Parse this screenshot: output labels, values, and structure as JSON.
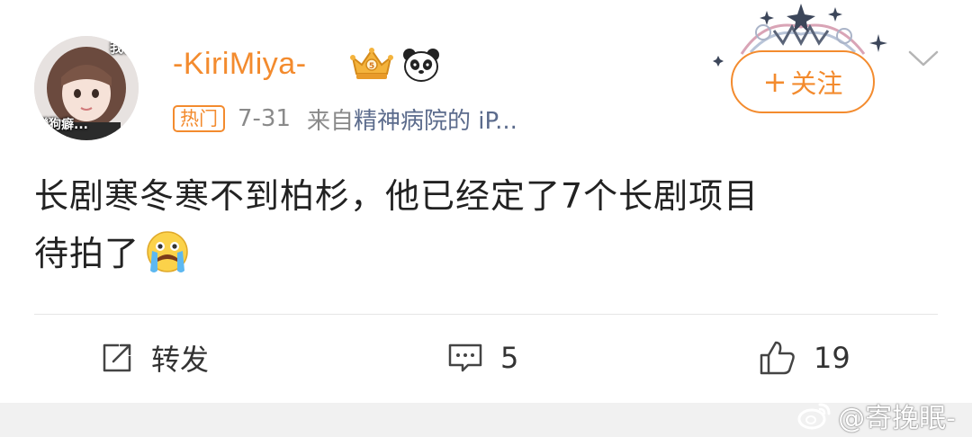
{
  "avatar": {
    "caption_top": "我佾",
    "caption_bottom": "戀狗癖..."
  },
  "user": {
    "name": "-KiriMiya-"
  },
  "meta": {
    "tag": "热门",
    "date": "7-31",
    "from_prefix": "来自",
    "source": "精神病院的 iP..."
  },
  "follow": {
    "plus": "+",
    "label": "关注"
  },
  "post": {
    "line1": "长剧寒冬寒不到柏杉，他已经定了7个长剧项目",
    "line2": "待拍了"
  },
  "actions": {
    "repost_label": "转发",
    "comment_count": "5",
    "like_count": "19"
  },
  "watermark": {
    "text": "@寄挽眠-"
  },
  "colors": {
    "accent": "#f38b2e",
    "link": "#5b6b8c",
    "meta": "#8a8a8a"
  }
}
